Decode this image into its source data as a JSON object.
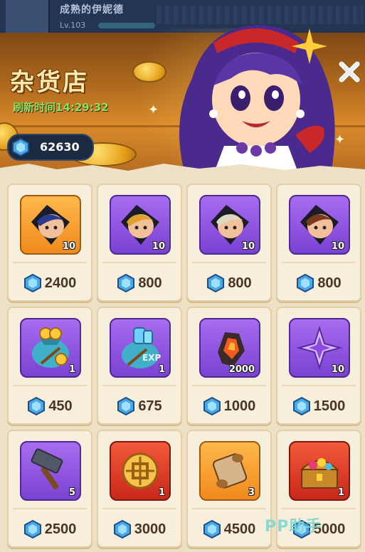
{
  "player": {
    "name": "成熟的伊妮德",
    "level": "Lv.103"
  },
  "shop": {
    "title": "杂货店",
    "refresh_label": "刷新时间14:29:32"
  },
  "currency": {
    "icon": "blue-gem-icon",
    "amount": "62630"
  },
  "items": [
    {
      "name": "hero-shard-dark-hair",
      "icon": "hero-portrait-icon",
      "quantity": "10",
      "price": "2400",
      "bg": "orange"
    },
    {
      "name": "hero-shard-blonde",
      "icon": "hero-portrait-icon",
      "quantity": "10",
      "price": "800",
      "bg": "purple"
    },
    {
      "name": "hero-shard-grey-hair",
      "icon": "hero-portrait-icon",
      "quantity": "10",
      "price": "800",
      "bg": "purple"
    },
    {
      "name": "hero-shard-headband",
      "icon": "hero-portrait-icon",
      "quantity": "10",
      "price": "800",
      "bg": "purple"
    },
    {
      "name": "coin-bag",
      "icon": "coin-bag-icon",
      "quantity": "1",
      "price": "450",
      "bg": "purple"
    },
    {
      "name": "exp-bag",
      "icon": "exp-bag-icon",
      "quantity": "1",
      "price": "675",
      "bg": "purple"
    },
    {
      "name": "fire-stone",
      "icon": "fire-stone-icon",
      "quantity": "2000",
      "price": "1000",
      "bg": "purple"
    },
    {
      "name": "purple-star",
      "icon": "shuriken-star-icon",
      "quantity": "10",
      "price": "1500",
      "bg": "purple"
    },
    {
      "name": "hammer",
      "icon": "hammer-icon",
      "quantity": "5",
      "price": "2500",
      "bg": "purple"
    },
    {
      "name": "gold-emblem",
      "icon": "gold-emblem-icon",
      "quantity": "1",
      "price": "3000",
      "bg": "red"
    },
    {
      "name": "scroll",
      "icon": "scroll-icon",
      "quantity": "3",
      "price": "4500",
      "bg": "orange"
    },
    {
      "name": "treasure-chest",
      "icon": "treasure-chest-icon",
      "quantity": "1",
      "price": "5000",
      "bg": "red"
    }
  ],
  "watermark": "PP助手",
  "colors": {
    "price_text": "#4a3422",
    "title_text": "#ffe9a8",
    "refresh_text": "#8de05a",
    "gem": "#4aa8e6"
  }
}
